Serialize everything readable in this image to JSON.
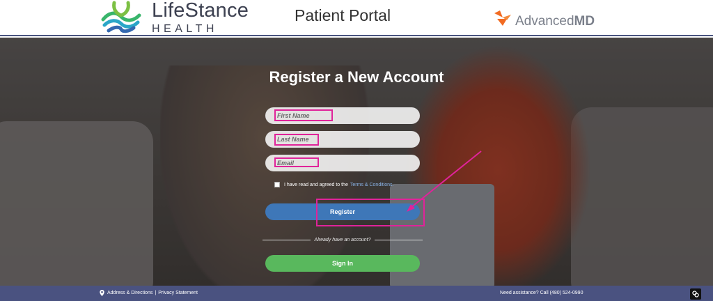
{
  "header": {
    "logo": {
      "line1": "LifeStance",
      "line2": "HEALTH"
    },
    "title": "Patient Portal",
    "partner_logo": {
      "text_light": "Advanced",
      "text_bold": "MD"
    }
  },
  "form": {
    "heading": "Register a New Account",
    "first_name_placeholder": "First Name",
    "last_name_placeholder": "Last Name",
    "email_placeholder": "Email",
    "terms_text": "I have read and agreed to the",
    "terms_link": "Terms & Conditions.",
    "register_label": "Register",
    "divider_text": "Already have an account?",
    "signin_label": "Sign In"
  },
  "footer": {
    "address_link": "Address & Directions",
    "separator": "|",
    "privacy_link": "Privacy Statement",
    "assistance": "Need assistance? Call (480) 524-0990"
  },
  "colors": {
    "annotation": "#e0239a",
    "register_button": "#3e77b8",
    "signin_button": "#59b85d",
    "footer_bg": "#4a5280"
  },
  "icons": [
    "lifestance-logo-icon",
    "advancedmd-logo-icon",
    "map-pin-icon",
    "link-icon"
  ]
}
